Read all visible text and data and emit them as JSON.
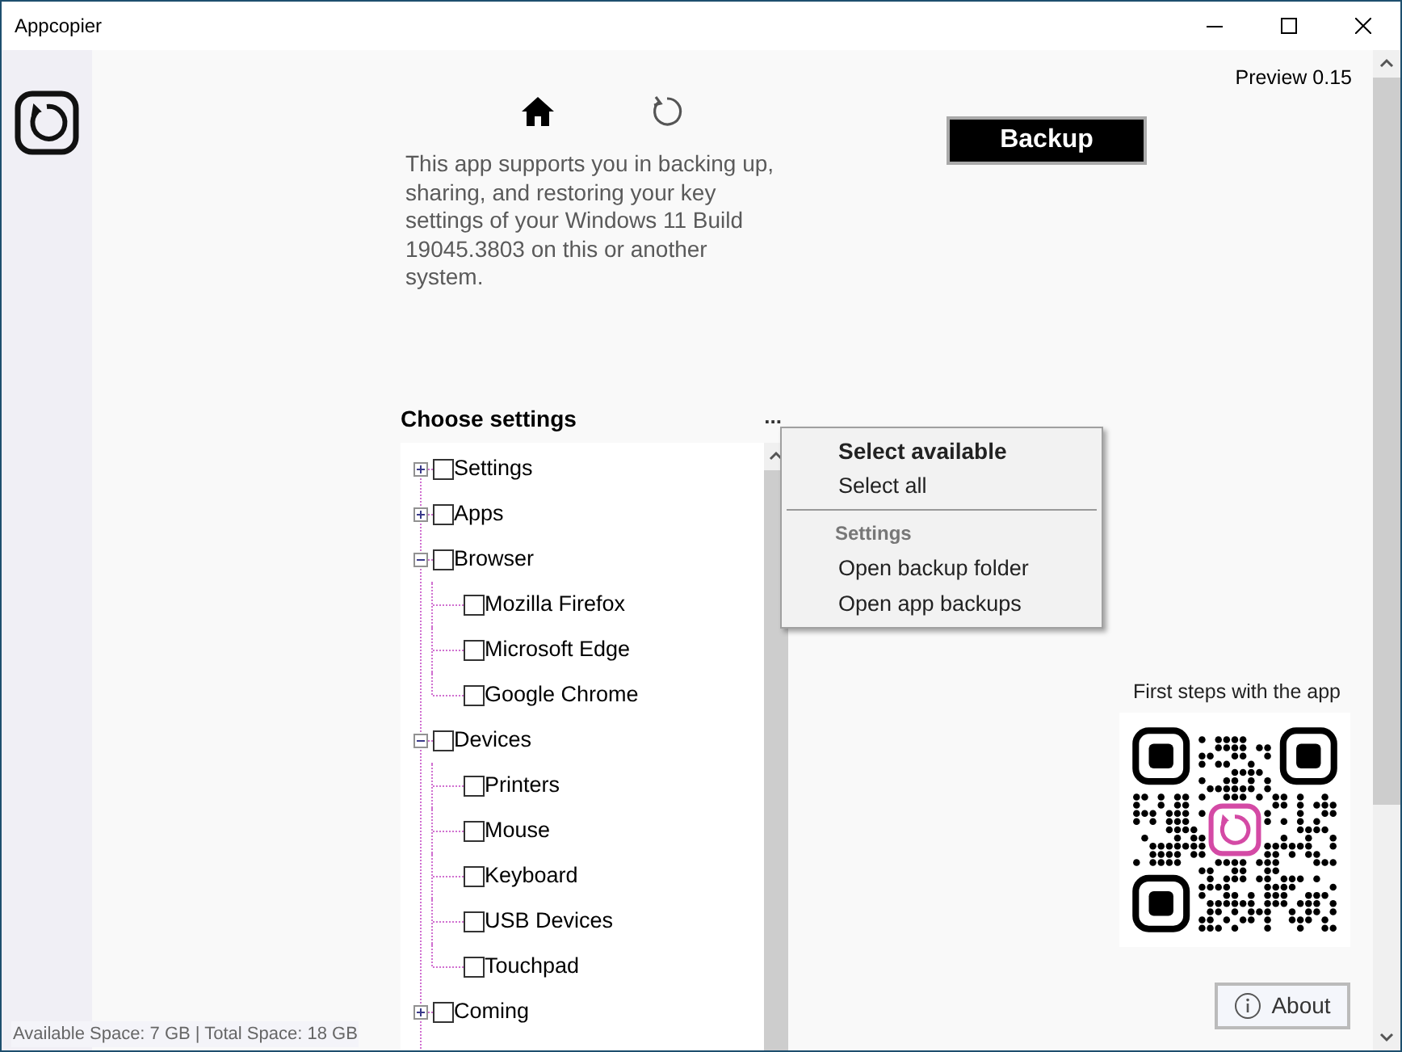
{
  "window": {
    "title": "Appcopier"
  },
  "version": "Preview 0.15",
  "backup_button": "Backup",
  "description": "This app supports you in backing up, sharing, and restoring your key settings of your Windows 11 Build 19045.3803 on this or another system.",
  "tree": {
    "title": "Choose settings",
    "more": "...",
    "items": [
      {
        "label": "Settings",
        "checked": false,
        "expanded": false
      },
      {
        "label": "Apps",
        "checked": false,
        "expanded": false
      },
      {
        "label": "Browser",
        "checked": false,
        "expanded": true,
        "children": [
          {
            "label": "Mozilla Firefox",
            "checked": false
          },
          {
            "label": "Microsoft Edge",
            "checked": false
          },
          {
            "label": "Google Chrome",
            "checked": false
          }
        ]
      },
      {
        "label": "Devices",
        "checked": false,
        "expanded": true,
        "children": [
          {
            "label": "Printers",
            "checked": false
          },
          {
            "label": "Mouse",
            "checked": false
          },
          {
            "label": "Keyboard",
            "checked": false
          },
          {
            "label": "USB Devices",
            "checked": false
          },
          {
            "label": "Touchpad",
            "checked": false
          }
        ]
      },
      {
        "label": "Coming",
        "checked": false,
        "expanded": false
      }
    ]
  },
  "context_menu": {
    "items": [
      {
        "kind": "default",
        "label": "Select available"
      },
      {
        "kind": "item",
        "label": "Select all"
      },
      {
        "kind": "separator"
      },
      {
        "kind": "header",
        "label": "Settings"
      },
      {
        "kind": "item",
        "label": "Open backup folder"
      },
      {
        "kind": "item",
        "label": "Open app backups"
      }
    ]
  },
  "qr": {
    "caption": "First steps with the app"
  },
  "about_button": "About",
  "status_bar": "Available Space: 7 GB | Total Space: 18 GB"
}
